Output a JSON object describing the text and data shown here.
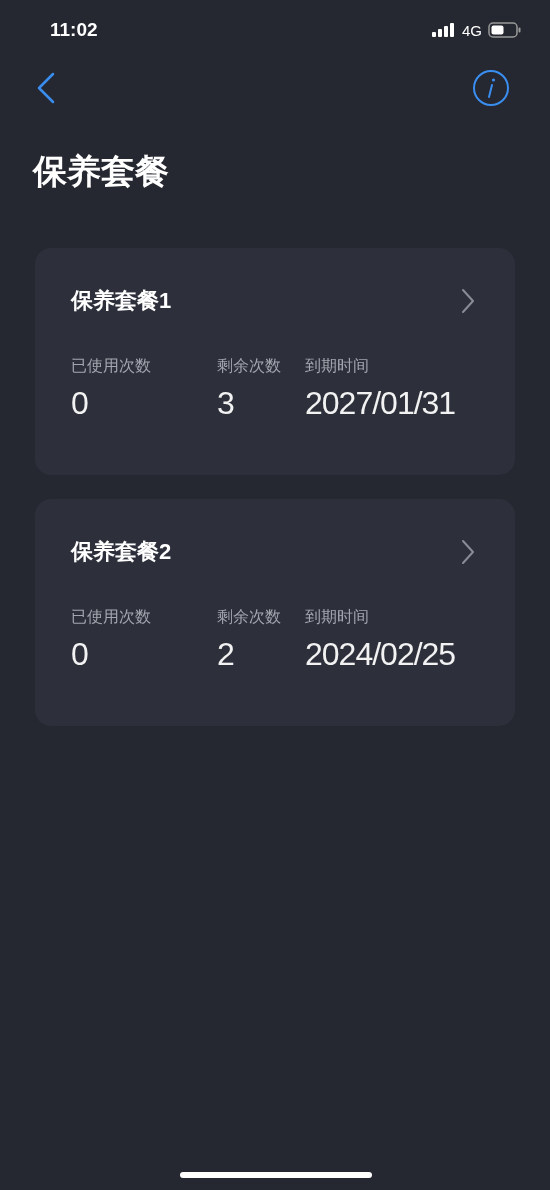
{
  "status_bar": {
    "time": "11:02",
    "network": "4G"
  },
  "title": "保养套餐",
  "packages": [
    {
      "name": "保养套餐1",
      "stats": [
        {
          "label": "已使用次数",
          "value": "0"
        },
        {
          "label": "剩余次数",
          "value": "3"
        },
        {
          "label": "到期时间",
          "value": "2027/01/31"
        }
      ]
    },
    {
      "name": "保养套餐2",
      "stats": [
        {
          "label": "已使用次数",
          "value": "0"
        },
        {
          "label": "剩余次数",
          "value": "2"
        },
        {
          "label": "到期时间",
          "value": "2024/02/25"
        }
      ]
    }
  ]
}
